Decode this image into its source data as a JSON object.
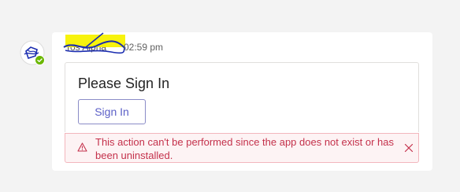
{
  "message": {
    "sender_name": "Tos Alpha",
    "timestamp": "02:59 pm"
  },
  "card": {
    "title": "Please Sign In",
    "signin_label": "Sign In"
  },
  "error": {
    "text": "This action can't be performed since the app does not exist or has been uninstalled."
  },
  "icons": {
    "avatar": "bot-avatar-icon",
    "presence": "checkmark-icon",
    "warning": "warning-icon",
    "close": "close-icon"
  },
  "colors": {
    "background": "#f3f3f3",
    "bubble": "#ffffff",
    "presence": "#6bb700",
    "highlight": "#f7f200",
    "scribble": "#1b2db0",
    "button_text": "#5b5fc7",
    "error_text": "#c4314b",
    "error_background": "#fdf3f4"
  }
}
